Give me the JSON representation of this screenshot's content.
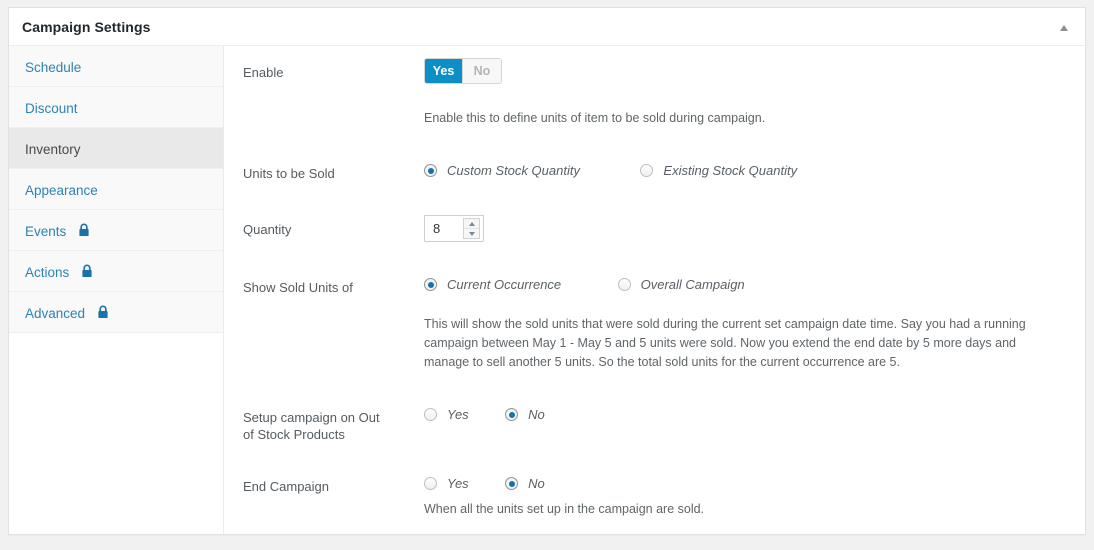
{
  "header": {
    "title": "Campaign Settings",
    "collapse_icon": "chevron-up-icon"
  },
  "sidebar": {
    "items": [
      {
        "label": "Schedule",
        "active": false,
        "locked": false
      },
      {
        "label": "Discount",
        "active": false,
        "locked": false
      },
      {
        "label": "Inventory",
        "active": true,
        "locked": false
      },
      {
        "label": "Appearance",
        "active": false,
        "locked": false
      },
      {
        "label": "Events",
        "active": false,
        "locked": true
      },
      {
        "label": "Actions",
        "active": false,
        "locked": true
      },
      {
        "label": "Advanced",
        "active": false,
        "locked": true
      }
    ],
    "lock_icon": "lock-icon"
  },
  "fields": {
    "enable": {
      "label": "Enable",
      "toggle": {
        "yes": "Yes",
        "no": "No",
        "value": "Yes"
      },
      "description": "Enable this to define units of item to be sold during campaign."
    },
    "units_to_be_sold": {
      "label": "Units to be Sold",
      "options": [
        {
          "text": "Custom Stock Quantity",
          "checked": true
        },
        {
          "text": "Existing Stock Quantity",
          "checked": false
        }
      ]
    },
    "quantity": {
      "label": "Quantity",
      "value": "8"
    },
    "show_sold_units_of": {
      "label": "Show Sold Units of",
      "options": [
        {
          "text": "Current Occurrence",
          "checked": true
        },
        {
          "text": "Overall Campaign",
          "checked": false
        }
      ],
      "description": "This will show the sold units that were sold during the current set campaign date time. Say you had a running campaign between May 1 - May 5 and 5 units were sold. Now you extend the end date by 5 more days and manage to sell another 5 units. So the total sold units for the current occurrence are 5."
    },
    "out_of_stock": {
      "label": "Setup campaign on Out of Stock Products",
      "options": [
        {
          "text": "Yes",
          "checked": false
        },
        {
          "text": "No",
          "checked": true
        }
      ]
    },
    "end_campaign": {
      "label": "End Campaign",
      "options": [
        {
          "text": "Yes",
          "checked": false
        },
        {
          "text": "No",
          "checked": true
        }
      ],
      "description": "When all the units set up in the campaign are sold."
    }
  },
  "colors": {
    "accent": "#0e8ec6",
    "link": "#2d82b5",
    "active_bg": "#e9e9e9",
    "radio_fill": "#1572ad"
  }
}
